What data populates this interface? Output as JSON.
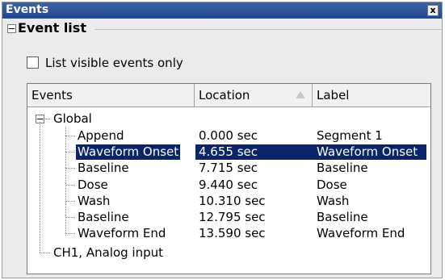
{
  "window": {
    "title": "Events",
    "close_label": "x"
  },
  "section": {
    "title": "Event list"
  },
  "options": {
    "visible_only_label": "List visible events only",
    "visible_only_checked": false
  },
  "table": {
    "columns": [
      "Events",
      "Location",
      "Label"
    ],
    "root": "Global",
    "rows": [
      {
        "name": "Append",
        "location": "0.000 sec",
        "label": "Segment 1",
        "selected": false
      },
      {
        "name": "Waveform Onset",
        "location": "4.655 sec",
        "label": "Waveform Onset",
        "selected": true
      },
      {
        "name": "Baseline",
        "location": "7.715 sec",
        "label": "Baseline",
        "selected": false
      },
      {
        "name": "Dose",
        "location": "9.440 sec",
        "label": "Dose",
        "selected": false
      },
      {
        "name": "Wash",
        "location": "10.310 sec",
        "label": "Wash",
        "selected": false
      },
      {
        "name": "Baseline",
        "location": "12.795 sec",
        "label": "Baseline",
        "selected": false
      },
      {
        "name": "Waveform End",
        "location": "13.590 sec",
        "label": "Waveform End",
        "selected": false
      }
    ],
    "channel": "CH1, Analog input"
  }
}
